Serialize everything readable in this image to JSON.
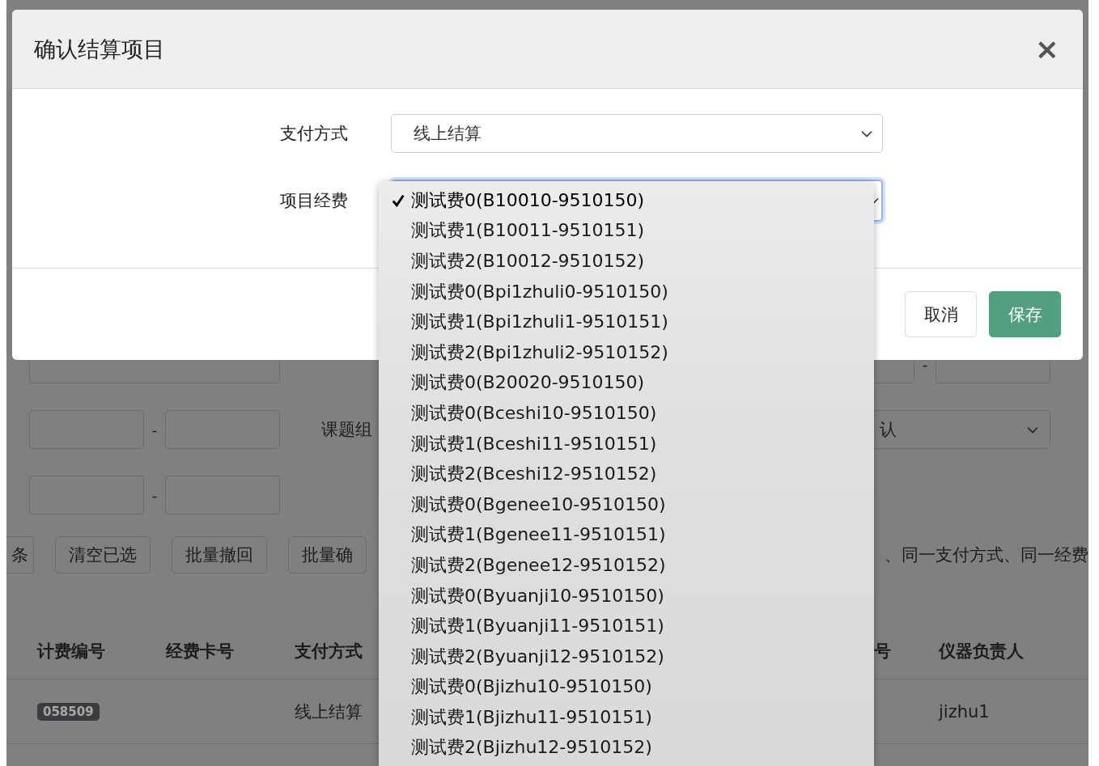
{
  "background": {
    "filter_rows": [
      {
        "left": {
          "kind": "wide"
        },
        "right": {
          "kind": "range",
          "separator": "-"
        }
      },
      {
        "left": {
          "kind": "range",
          "separator": "-"
        },
        "label": "课题组",
        "right": {
          "kind": "select",
          "value": "认"
        }
      },
      {
        "left": {
          "kind": "range",
          "separator": "-"
        }
      }
    ],
    "actions": [
      "条",
      "清空已选",
      "批量撤回",
      "批量确"
    ],
    "note": "、同一支付方式、同一经费",
    "table": {
      "columns": [
        "计费编号",
        "经费卡号",
        "支付方式",
        "号",
        "仪器负责人"
      ],
      "rows": [
        {
          "cells": [
            {
              "kind": "badge",
              "text": "058509"
            },
            {
              "kind": "empty"
            },
            {
              "kind": "text",
              "text": "线上结算"
            },
            {
              "kind": "empty"
            },
            {
              "kind": "text",
              "text": "jizhu1"
            }
          ]
        }
      ]
    }
  },
  "dialog": {
    "title": "确认结算项目",
    "close": "×",
    "fields": [
      {
        "label": "支付方式",
        "value": "线上结算",
        "focused": false
      },
      {
        "label": "项目经费",
        "focused": true
      }
    ],
    "buttons": [
      {
        "label": "取消",
        "kind": "default"
      },
      {
        "label": "保存",
        "kind": "primary"
      }
    ]
  },
  "dropdown": {
    "options": [
      {
        "label": "测试费0(B10010-9510150)",
        "selected": true
      },
      {
        "label": "测试费1(B10011-9510151)",
        "selected": false
      },
      {
        "label": "测试费2(B10012-9510152)",
        "selected": false
      },
      {
        "label": "测试费0(Bpi1zhuli0-9510150)",
        "selected": false
      },
      {
        "label": "测试费1(Bpi1zhuli1-9510151)",
        "selected": false
      },
      {
        "label": "测试费2(Bpi1zhuli2-9510152)",
        "selected": false
      },
      {
        "label": "测试费0(B20020-9510150)",
        "selected": false
      },
      {
        "label": "测试费0(Bceshi10-9510150)",
        "selected": false
      },
      {
        "label": "测试费1(Bceshi11-9510151)",
        "selected": false
      },
      {
        "label": "测试费2(Bceshi12-9510152)",
        "selected": false
      },
      {
        "label": "测试费0(Bgenee10-9510150)",
        "selected": false
      },
      {
        "label": "测试费1(Bgenee11-9510151)",
        "selected": false
      },
      {
        "label": "测试费2(Bgenee12-9510152)",
        "selected": false
      },
      {
        "label": "测试费0(Byuanji10-9510150)",
        "selected": false
      },
      {
        "label": "测试费1(Byuanji11-9510151)",
        "selected": false
      },
      {
        "label": "测试费2(Byuanji12-9510152)",
        "selected": false
      },
      {
        "label": "测试费0(Bjizhu10-9510150)",
        "selected": false
      },
      {
        "label": "测试费1(Bjizhu11-9510151)",
        "selected": false
      },
      {
        "label": "测试费2(Bjizhu12-9510152)",
        "selected": false
      }
    ]
  }
}
